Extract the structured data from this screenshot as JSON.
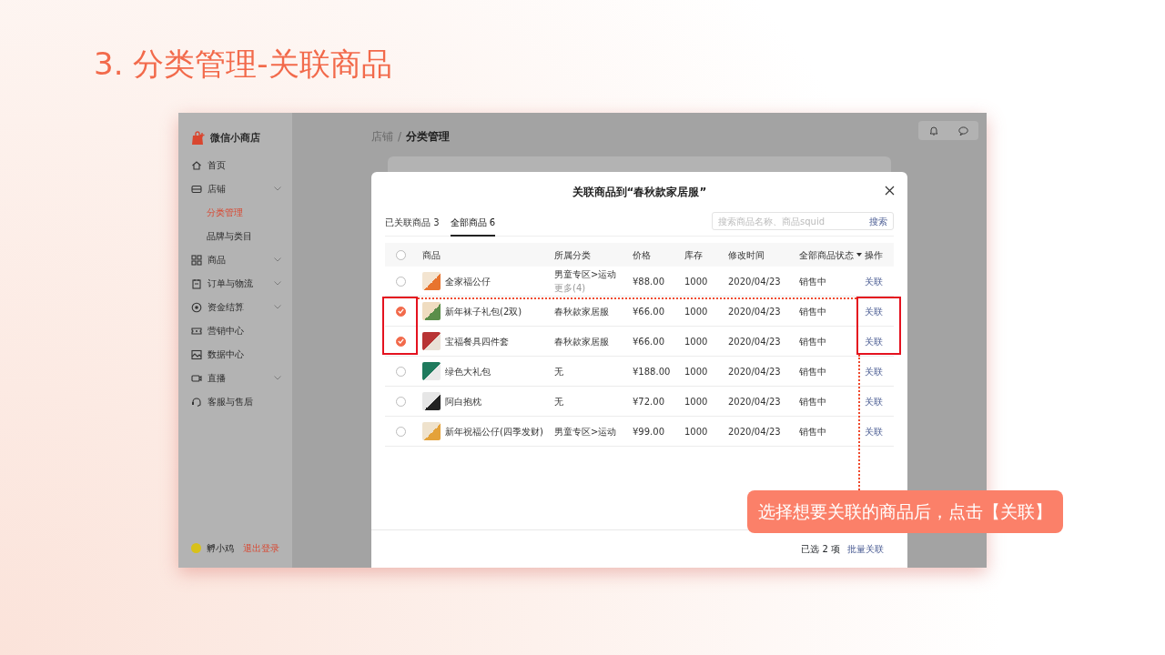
{
  "slide": {
    "title": "3. 分类管理-关联商品"
  },
  "app": {
    "brand": "微信小商店",
    "nav": [
      {
        "label": "首页",
        "collapsible": false,
        "selected": false
      },
      {
        "label": "店铺",
        "collapsible": true,
        "selected": false,
        "children": [
          {
            "label": "分类管理",
            "selected": true
          },
          {
            "label": "品牌与类目",
            "selected": false
          }
        ]
      },
      {
        "label": "商品",
        "collapsible": true,
        "selected": false
      },
      {
        "label": "订单与物流",
        "collapsible": true,
        "selected": false
      },
      {
        "label": "资金结算",
        "collapsible": true,
        "selected": false
      },
      {
        "label": "营销中心",
        "collapsible": false,
        "selected": false
      },
      {
        "label": "数据中心",
        "collapsible": false,
        "selected": false
      },
      {
        "label": "直播",
        "collapsible": true,
        "selected": false
      },
      {
        "label": "客服与售后",
        "collapsible": false,
        "selected": false
      }
    ],
    "user": {
      "name": "孵小鸡",
      "logout": "退出登录"
    },
    "breadcrumb": {
      "separator": "/",
      "items": [
        "店铺",
        "分类管理"
      ]
    }
  },
  "modal": {
    "title": "关联商品到“春秋款家居服”",
    "tabs": [
      {
        "label": "已关联商品 3",
        "selected": false
      },
      {
        "label": "全部商品 6",
        "selected": true
      }
    ],
    "search": {
      "placeholder": "搜索商品名称、商品squid",
      "button": "搜索"
    },
    "select_all_checked": false,
    "columns": [
      {
        "label": "商品",
        "dropdown": false
      },
      {
        "label": "所属分类",
        "dropdown": false
      },
      {
        "label": "价格",
        "dropdown": false
      },
      {
        "label": "库存",
        "dropdown": false
      },
      {
        "label": "修改时间",
        "dropdown": false
      },
      {
        "label": "全部商品状态",
        "dropdown": true
      },
      {
        "label": "操作",
        "dropdown": false
      }
    ],
    "rows": [
      {
        "checked": false,
        "name": "全家福公仔",
        "category": "男童专区>运动",
        "category_more": "更多(4)",
        "price": "¥88.00",
        "stock": "1000",
        "modified": "2020/04/23",
        "status": "销售中",
        "action": "关联"
      },
      {
        "checked": true,
        "name": "新年袜子礼包(2双)",
        "category": "春秋款家居服",
        "price": "¥66.00",
        "stock": "1000",
        "modified": "2020/04/23",
        "status": "销售中",
        "action": "关联"
      },
      {
        "checked": true,
        "name": "宝福餐具四件套",
        "category": "春秋款家居服",
        "price": "¥66.00",
        "stock": "1000",
        "modified": "2020/04/23",
        "status": "销售中",
        "action": "关联"
      },
      {
        "checked": false,
        "name": "绿色大礼包",
        "category": "无",
        "price": "¥188.00",
        "stock": "1000",
        "modified": "2020/04/23",
        "status": "销售中",
        "action": "关联"
      },
      {
        "checked": false,
        "name": "阿白抱枕",
        "category": "无",
        "price": "¥72.00",
        "stock": "1000",
        "modified": "2020/04/23",
        "status": "销售中",
        "action": "关联"
      },
      {
        "checked": false,
        "name": "新年祝福公仔(四季发财)",
        "category": "男童专区>运动",
        "price": "¥99.00",
        "stock": "1000",
        "modified": "2020/04/23",
        "status": "销售中",
        "action": "关联"
      }
    ],
    "footer": {
      "selected_count": "已选 2 项",
      "bulk_button": "批量关联"
    }
  },
  "callout": "选择想要关联的商品后，点击【关联】"
}
